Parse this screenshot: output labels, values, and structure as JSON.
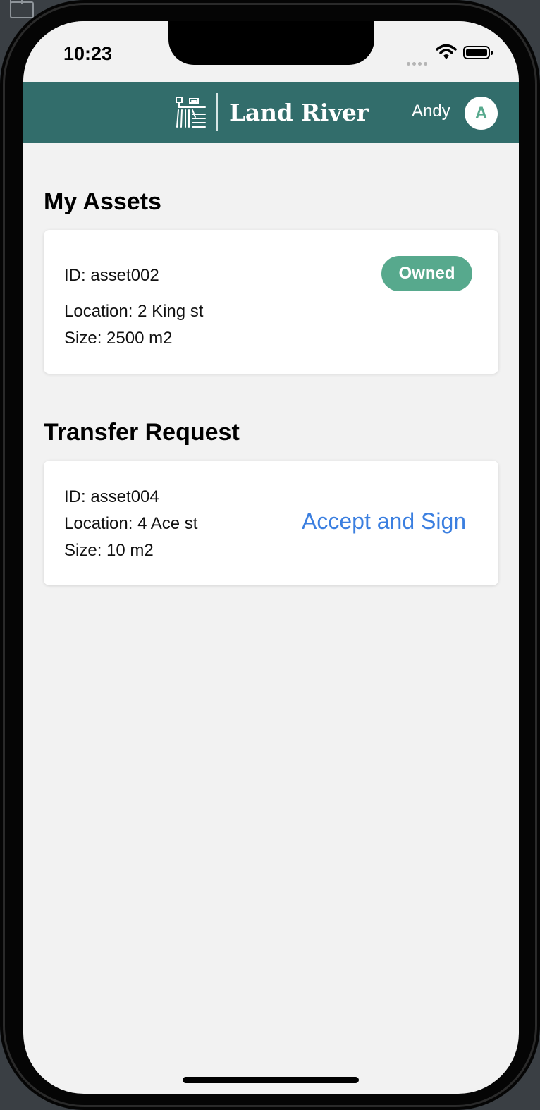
{
  "status_bar": {
    "time": "10:23"
  },
  "header": {
    "brand": "Land River",
    "user_name": "Andy",
    "avatar_initial": "A",
    "background_color": "#326d6b"
  },
  "my_assets": {
    "title": "My Assets",
    "asset": {
      "id_label": "ID: asset002",
      "location_label": "Location: 2 King st",
      "size_label": "Size: 2500 m2",
      "status": "Owned",
      "status_color": "#57a98d"
    }
  },
  "transfer_request": {
    "title": "Transfer Request",
    "asset": {
      "id_label": "ID: asset004",
      "location_label": "Location: 4 Ace st",
      "size_label": "Size: 10 m2"
    },
    "action_label": "Accept and Sign",
    "action_color": "#3b7fe0"
  }
}
